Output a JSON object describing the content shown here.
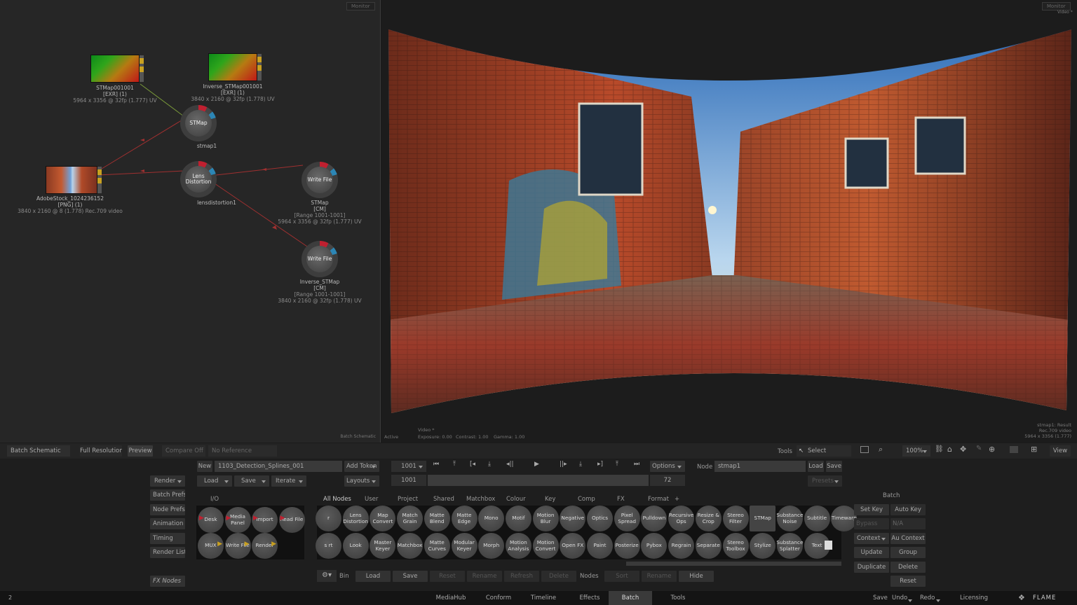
{
  "schematic": {
    "monitor_tag": "Monitor",
    "footer_label": "Batch Schematic",
    "nodes": {
      "stmap_src": {
        "name": "STMap001001",
        "format": "[EXR] (1)",
        "meta": "5964 x 3356 @ 32fp (1.777)  UV"
      },
      "inv_src": {
        "name": "Inverse_STMap001001",
        "format": "[EXR] (1)",
        "meta": "3840 x 2160 @ 32fp (1.778)  UV"
      },
      "stmap_node": {
        "core": "STMap",
        "name": "stmap1"
      },
      "adobe_src": {
        "name": "AdobeStock_1024236152",
        "format": "[PNG] (1)",
        "meta": "3840 x 2160 @ 8 (1.778)  Rec.709 video"
      },
      "lens_node": {
        "core": "Lens Distortion",
        "name": "lensdistortion1"
      },
      "write_stmap": {
        "core": "Write File",
        "name": "STMap",
        "tag": "[CM]",
        "range": "[Range 1001-1001]",
        "meta": "5964 x 3356 @ 32fp (1.777)  UV"
      },
      "write_inv": {
        "core": "Write File",
        "name": "Inverse_STMap",
        "tag": "[CM]",
        "range": "[Range 1001-1001]",
        "meta": "3840 x 2160 @ 32fp (1.778)  UV"
      }
    }
  },
  "viewer": {
    "monitor_tag": "Monitor",
    "video_tag": "Video *",
    "status_active": "Active",
    "video_label": "Video *",
    "exposure": "Exposure: 0.00",
    "contrast": "Contrast: 1.00",
    "gamma": "Gamma: 1.00",
    "info_line1": "stmap1: Result",
    "info_line2": "Rec.709 video",
    "info_line3": "5964 x 3356 (1.777)"
  },
  "viewbar": {
    "batch_schematic": "Batch Schematic",
    "full_res": "Full Resolution",
    "preview": "Preview",
    "compare": "Compare Off",
    "no_ref": "No Reference",
    "tools": "Tools",
    "select": "Select",
    "zoom": "100%",
    "view": "View"
  },
  "controls": {
    "new": "New",
    "setup_name": "1103_Detection_Splines_001",
    "add_token": "Add Token",
    "frame": "1001",
    "options": "Options",
    "node_label": "Node",
    "node_value": "stmap1",
    "load": "Load",
    "save": "Save",
    "render": "Render",
    "load2": "Load",
    "save2": "Save",
    "iterate": "Iterate",
    "layouts": "Layouts",
    "range_start": "1001",
    "range_end": "72",
    "presets": "Presets"
  },
  "left_menu": [
    "Batch Prefs",
    "Node Prefs",
    "Animation",
    "Timing",
    "Render List"
  ],
  "fx_nodes": "FX Nodes",
  "io": {
    "title": "I/O",
    "row1": [
      "Desk",
      "Media Panel",
      "Import",
      "Read File"
    ],
    "row2": [
      "MUX",
      "Write File",
      "Render"
    ]
  },
  "bin_tabs": [
    "All Nodes",
    "User",
    "Project",
    "Shared",
    "Matchbox",
    "Colour",
    "Key",
    "Comp",
    "FX",
    "Format",
    "+"
  ],
  "tiles_row1": [
    "r",
    "Lens Distortion",
    "Map Convert",
    "Match Grain",
    "Matte Blend",
    "Matte Edge",
    "Mono",
    "Motif",
    "Motion Blur",
    "Negative",
    "Optics",
    "Pixel Spread",
    "Pulldown",
    "Recursive Ops",
    "Resize & Crop",
    "Stereo Filter",
    "STMap",
    "Substance Noise",
    "Subtitle",
    "Timewarp"
  ],
  "tiles_row2": [
    "s rt",
    "Look",
    "Master Keyer",
    "Matchbox",
    "Matte Curves",
    "Modular Keyer",
    "Morph",
    "Motion Analysis",
    "Motion Convert",
    "Open FX",
    "Paint",
    "Posterize",
    "Pybox",
    "Regrain",
    "Separate",
    "Stereo Toolbox",
    "Stylize",
    "Substance Splatter",
    "Text"
  ],
  "bin_bar": {
    "bin": "Bin",
    "load": "Load",
    "save": "Save",
    "reset": "Reset",
    "rename": "Rename",
    "refresh": "Refresh",
    "delete": "Delete",
    "nodes": "Nodes",
    "sort": "Sort",
    "rename2": "Rename",
    "hide": "Hide"
  },
  "batch_panel": {
    "title": "Batch",
    "set_key": "Set Key",
    "auto_key": "Auto Key",
    "bypass": "Bypass",
    "na": "N/A",
    "context": "Context",
    "au_context": "Au Context",
    "update": "Update",
    "group": "Group",
    "duplicate": "Duplicate",
    "delete": "Delete",
    "reset": "Reset"
  },
  "bottom_tabs": [
    "MediaHub",
    "Conform",
    "Timeline",
    "Effects",
    "Batch",
    "Tools"
  ],
  "bottom_right": {
    "save": "Save",
    "undo": "Undo",
    "redo": "Redo",
    "licensing": "Licensing",
    "brand": "FLAME"
  },
  "bottom_left": "2",
  "colors": {
    "accent_red": "#c02030",
    "accent_blue": "#2c86b5",
    "accent_yellow": "#c8a020",
    "active_tab": "#3a3a3a"
  }
}
